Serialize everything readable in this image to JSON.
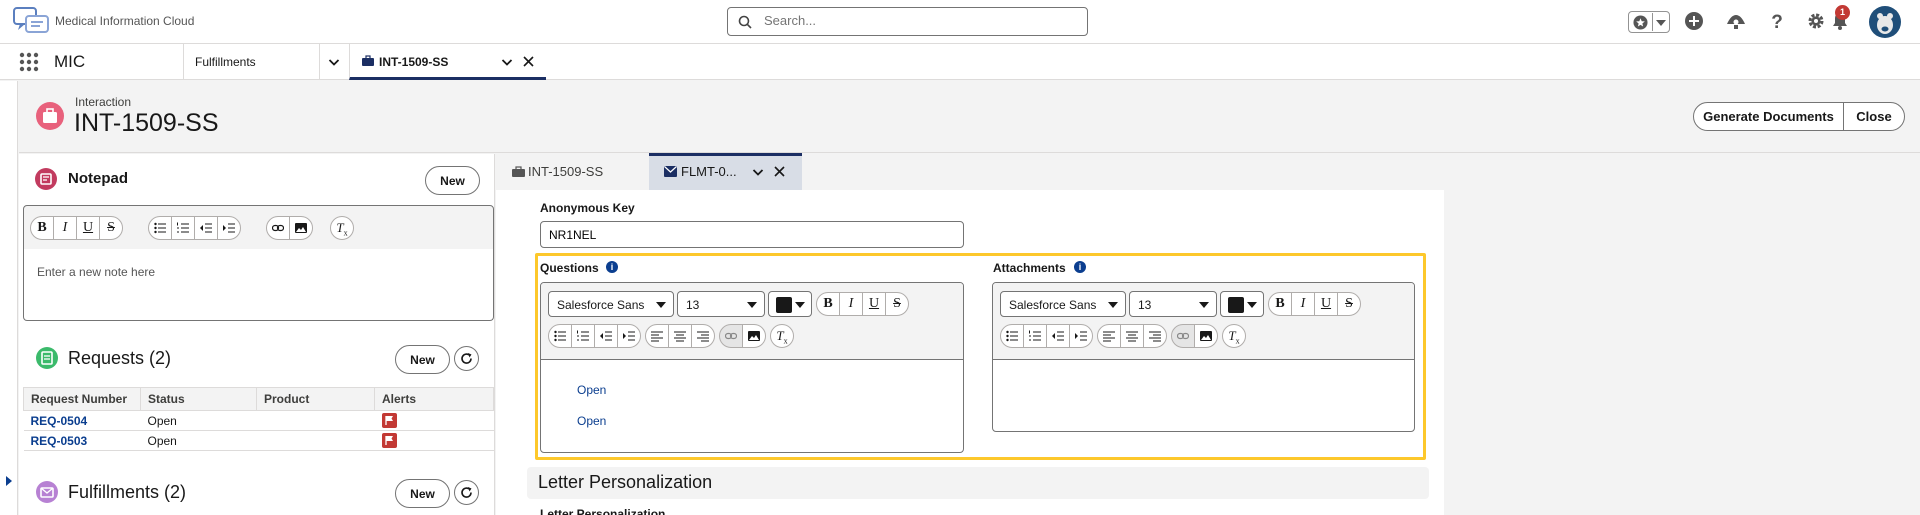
{
  "header": {
    "brand": "Medical Information Cloud",
    "search_placeholder": "Search...",
    "notification_count": "1"
  },
  "app_nav": {
    "app_name": "MIC",
    "tabs": [
      {
        "label": "Fulfillments"
      },
      {
        "label": "INT-1509-SS"
      }
    ]
  },
  "record": {
    "type": "Interaction",
    "title": "INT-1509-SS",
    "actions": {
      "generate": "Generate Documents",
      "close": "Close"
    }
  },
  "notepad": {
    "title": "Notepad",
    "new_label": "New",
    "placeholder": "Enter a new note here",
    "toolbar": [
      "B",
      "I",
      "U",
      "S"
    ]
  },
  "requests": {
    "title": "Requests (2)",
    "new_label": "New",
    "columns": [
      "Request Number",
      "Status",
      "Product",
      "Alerts"
    ],
    "rows": [
      {
        "number": "REQ-0504",
        "status": "Open",
        "product": ""
      },
      {
        "number": "REQ-0503",
        "status": "Open",
        "product": ""
      }
    ]
  },
  "fulfillments": {
    "title": "Fulfillments (2)",
    "new_label": "New"
  },
  "subtabs": [
    {
      "label": "INT-1509-SS"
    },
    {
      "label": "FLMT-0..."
    }
  ],
  "form": {
    "anonymous_key_label": "Anonymous Key",
    "anonymous_key_value": "NR1NEL",
    "questions_label": "Questions",
    "attachments_label": "Attachments",
    "font_family": "Salesforce Sans",
    "font_size": "13",
    "questions": [
      "Open",
      "Open"
    ],
    "section_title": "Letter Personalization",
    "section_field_label": "Letter Personalization"
  },
  "colors": {
    "accent_navy": "#1b2e63",
    "highlight": "#fdc82b",
    "record_icon": "#e8617c",
    "notepad_icon": "#c23b5f",
    "requests_icon": "#3bba6b",
    "fulfillments_icon": "#b781d3",
    "alert_flag": "#c23934"
  }
}
